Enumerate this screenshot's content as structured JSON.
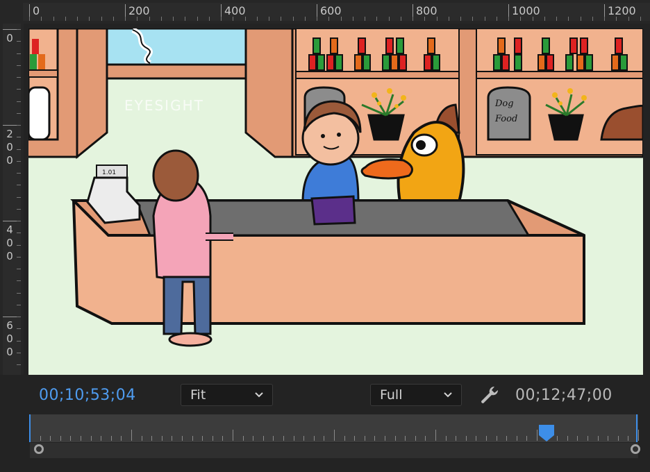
{
  "ruler_top": {
    "labels": [
      "0",
      "200",
      "400",
      "600",
      "800",
      "1000",
      "1200"
    ]
  },
  "ruler_left": {
    "labels": [
      "0",
      "200",
      "400",
      "600"
    ]
  },
  "scene": {
    "register_display": "1.01",
    "watermark": "EYESIGHT",
    "sign_dog_food": [
      "Dog",
      "Food"
    ]
  },
  "controls": {
    "current_timecode": "00;10;53;04",
    "zoom_select": {
      "selected": "Fit"
    },
    "resolution_select": {
      "selected": "Full"
    },
    "settings_icon": "wrench-icon",
    "duration_timecode": "00;12;47;00",
    "playhead_position_fraction": 0.849
  },
  "colors": {
    "accent_blue": "#4f9cf0",
    "panel_bg": "#232323"
  }
}
